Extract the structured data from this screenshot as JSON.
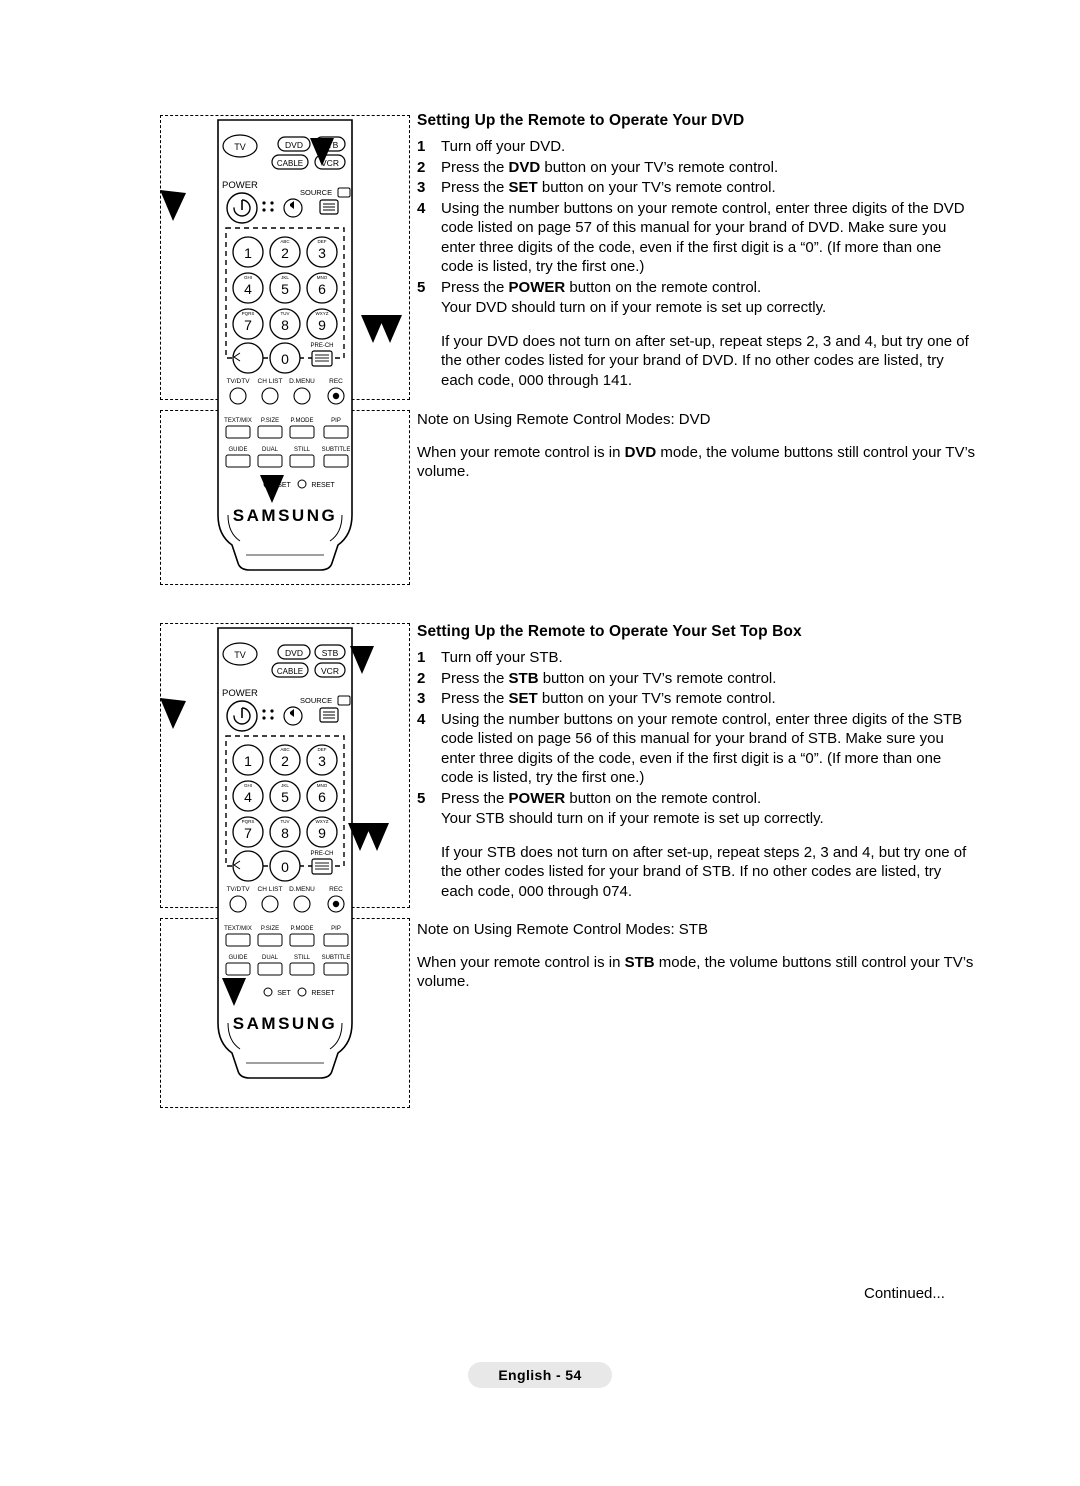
{
  "document": {
    "footer_note": "Continued...",
    "page_label": "English - 54"
  },
  "dvd_section": {
    "title": "Setting Up the Remote to Operate Your DVD",
    "steps": [
      {
        "num": "1",
        "text": "Turn off your DVD."
      },
      {
        "num": "2",
        "text_pre": "Press the ",
        "bold": "DVD",
        "text_post": " button on your TV’s remote control."
      },
      {
        "num": "3",
        "text_pre": "Press the ",
        "bold": "SET",
        "text_post": " button on your TV’s remote control."
      },
      {
        "num": "4",
        "text": "Using the number buttons on your remote control, enter three digits of the DVD code listed on page 57 of this manual for your brand of DVD. Make sure you enter three digits of the code, even if the first digit is a “0”. (If more than one code is listed, try the first one.)"
      },
      {
        "num": "5",
        "text_pre": "Press the ",
        "bold": "POWER",
        "text_post": " button on the remote control."
      }
    ],
    "result_line": "Your DVD should turn on if your remote is set up correctly.",
    "fallback_para": "If your DVD does not turn on after set-up, repeat steps 2, 3 and 4, but try one of the other codes listed for your brand of DVD. If no other codes are listed, try each code, 000 through 141.",
    "note_title": "Note on Using Remote Control Modes: DVD",
    "note_pre": "When your remote control is in ",
    "note_bold": "DVD",
    "note_post": " mode, the volume buttons still control your TV’s volume."
  },
  "stb_section": {
    "title": "Setting Up the Remote to Operate Your Set Top Box",
    "steps": [
      {
        "num": "1",
        "text": "Turn off your STB."
      },
      {
        "num": "2",
        "text_pre": "Press the ",
        "bold": "STB",
        "text_post": " button on your TV’s remote control."
      },
      {
        "num": "3",
        "text_pre": "Press the ",
        "bold": "SET",
        "text_post": " button on your TV’s remote control."
      },
      {
        "num": "4",
        "text": "Using the number buttons on your remote control, enter three digits of the STB code listed on page 56 of this manual for your brand of STB. Make sure you enter three digits of the code, even if the first digit is a “0”. (If more than one code is listed, try the first one.)"
      },
      {
        "num": "5",
        "text_pre": "Press the ",
        "bold": "POWER",
        "text_post": " button on the remote control."
      }
    ],
    "result_line": "Your STB should turn on if your remote is set up correctly.",
    "fallback_para": "If your STB does not turn on after set-up, repeat steps 2, 3 and 4, but try one of the other codes listed for your brand of STB. If no other codes are listed, try each code, 000 through 074.",
    "note_title": "Note on Using Remote Control Modes: STB",
    "note_pre": "When your remote control is in ",
    "note_bold": "STB",
    "note_post": " mode, the volume buttons still control your TV’s volume."
  },
  "remote": {
    "brand": "SAMSUNG",
    "mode_buttons_top": [
      "TV",
      "DVD",
      "STB",
      "CABLE",
      "VCR"
    ],
    "power_label": "POWER",
    "source_label": "SOURCE",
    "keypad": [
      "1",
      "2",
      "3",
      "4",
      "5",
      "6",
      "7",
      "8",
      "9",
      "0"
    ],
    "keypad_sub": [
      "",
      "ABC",
      "DEF",
      "GHI",
      "JKL",
      "MNO",
      "PQRS",
      "TUV",
      "WXYZ",
      ""
    ],
    "prech_label": "PRE-CH",
    "bottom_row": [
      "TV/DTV",
      "CH LIST",
      "D.MENU",
      "REC"
    ],
    "feature_row1": [
      "TEXT/MIX",
      "P.SIZE",
      "P.MODE",
      "PIP"
    ],
    "feature_row2": [
      "GUIDE",
      "DUAL",
      "STILL",
      "SUBTITLE"
    ],
    "set_label": "SET",
    "reset_label": "RESET"
  }
}
